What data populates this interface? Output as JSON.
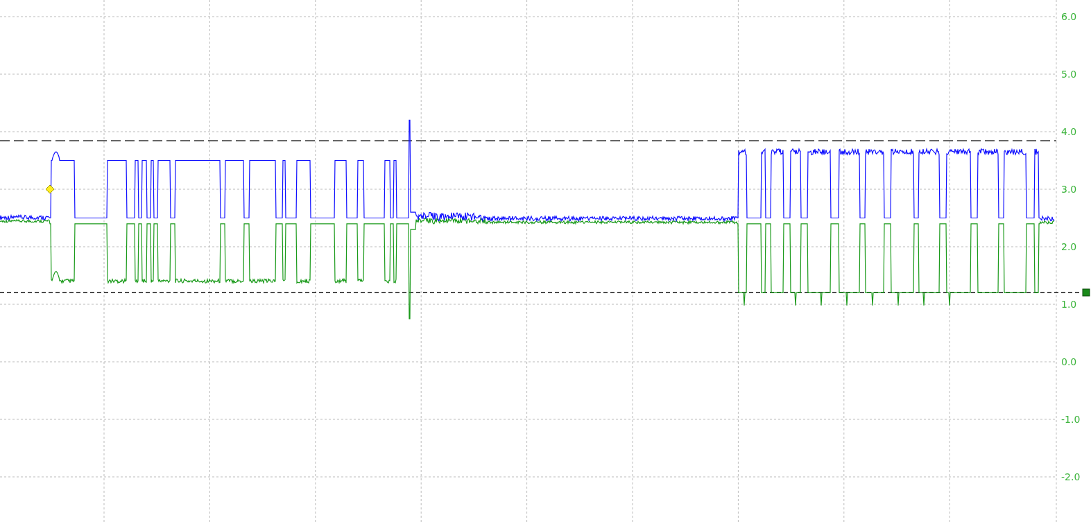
{
  "y_axis": {
    "tick_labels": [
      "6.0",
      "5.0",
      "4.0",
      "3.0",
      "2.0",
      "1.0",
      "0.0",
      "-1.0",
      "-2.0"
    ]
  }
}
